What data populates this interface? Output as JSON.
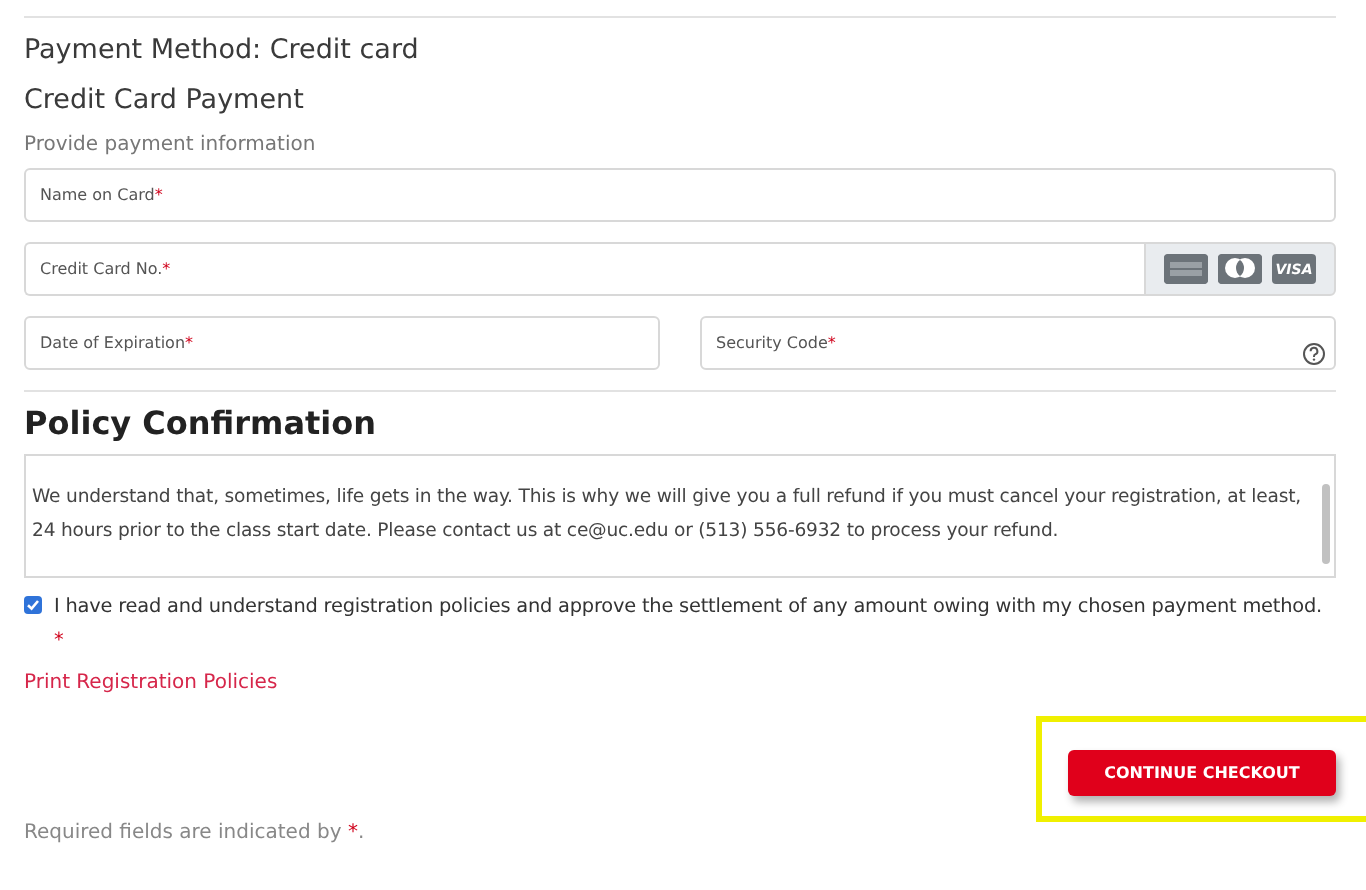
{
  "payment_method": "Payment Method: Credit card",
  "section_title": "Credit Card Payment",
  "instruction": "Provide payment information",
  "fields": [
    {
      "kind": "full",
      "label": "Name on Card",
      "mark": "*"
    },
    {
      "kind": "card",
      "label": "Credit Card No.",
      "mark": "*",
      "card_text": "VISA"
    },
    {
      "kind": "half",
      "label": "Date of Expiration",
      "mark": "*"
    },
    {
      "kind": "help",
      "label": "Security Code",
      "mark": "*"
    }
  ],
  "policy": {
    "title": "Policy Confirmation",
    "text": "We understand that, sometimes, life gets in the way. This is why we will give you a full refund if you must cancel your registration, at least, 24 hours prior to the class start date. Please contact us at ce@uc.edu or (513) 556-6932 to process your refund."
  },
  "agreement": {
    "checked": true,
    "text": "I have read and understand registration policies and approve the settlement of any amount owing with my chosen payment method.",
    "mark": "*"
  },
  "print_link": "Print Registration Policies",
  "checkout_button": {
    "label": "CONTINUE CHECKOUT",
    "highlighted": true
  },
  "footnote": {
    "text": "Required fields are indicated by",
    "mark": "*",
    "end": "."
  }
}
